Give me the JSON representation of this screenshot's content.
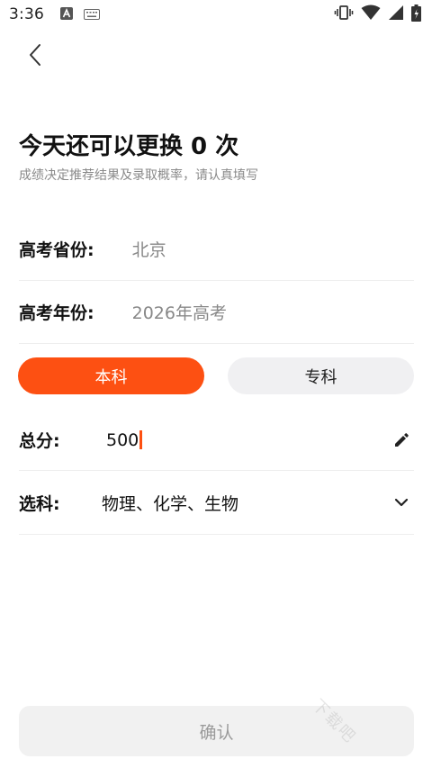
{
  "status_bar": {
    "time": "3:36",
    "left_icons": [
      "a-notification-icon",
      "keyboard-icon"
    ],
    "right_icons": [
      "vibrate-icon",
      "wifi-icon",
      "signal-icon",
      "battery-icon"
    ]
  },
  "header": {
    "back_icon": "back-chevron-icon"
  },
  "headline": "今天还可以更换 0 次",
  "subline": "成绩决定推荐结果及录取概率，请认真填写",
  "fields": {
    "province": {
      "label": "高考省份:",
      "value": "北京"
    },
    "year": {
      "label": "高考年份:",
      "value": "2026年高考"
    }
  },
  "tabs": {
    "bachelor": "本科",
    "associate": "专科",
    "active": "bachelor"
  },
  "score": {
    "label": "总分:",
    "value": "500",
    "edit_icon": "pencil-icon"
  },
  "subjects": {
    "label": "选科:",
    "value": "物理、化学、生物",
    "dropdown_icon": "chevron-down-icon"
  },
  "confirm_label": "确认",
  "watermark": "下载吧",
  "colors": {
    "accent": "#fd5012",
    "tab_inactive_bg": "#f0f0f2",
    "confirm_disabled_bg": "#f1f1f1",
    "muted_text": "#888888"
  }
}
